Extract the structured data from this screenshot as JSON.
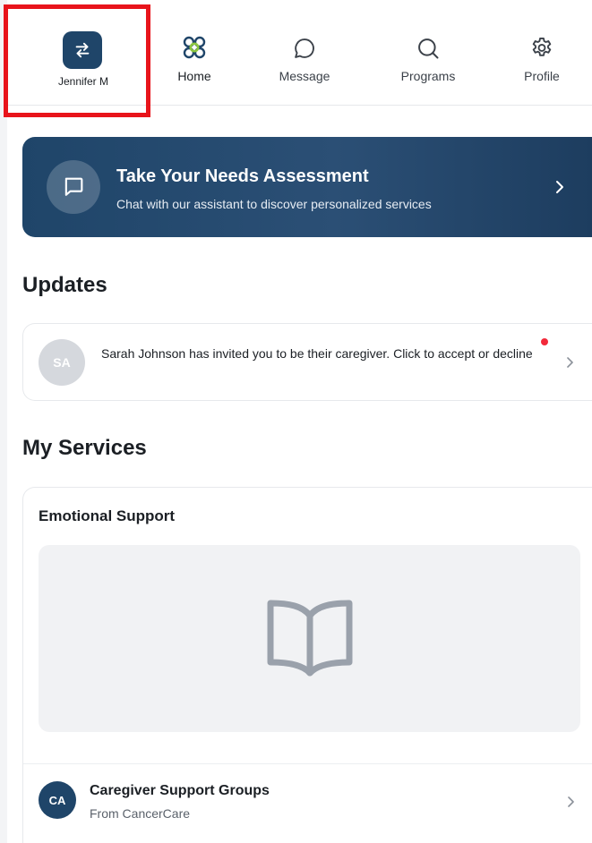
{
  "nav": {
    "switch_label": "Jennifer M",
    "items": [
      {
        "label": "Home",
        "icon": "home-logo-icon"
      },
      {
        "label": "Message",
        "icon": "message-icon"
      },
      {
        "label": "Programs",
        "icon": "search-icon"
      },
      {
        "label": "Profile",
        "icon": "gear-icon"
      }
    ]
  },
  "banner": {
    "title": "Take Your Needs Assessment",
    "subtitle": "Chat with our assistant to discover personalized services"
  },
  "updates": {
    "heading": "Updates",
    "items": [
      {
        "initials": "SA",
        "text": "Sarah Johnson has invited you to be their caregiver. Click to accept or decline"
      }
    ]
  },
  "services": {
    "heading": "My Services",
    "cards": [
      {
        "title": "Emotional Support",
        "items": [
          {
            "initials": "CA",
            "title": "Caregiver Support Groups",
            "subtitle": "From CancerCare"
          }
        ]
      }
    ]
  },
  "colors": {
    "brand_navy": "#1f4569",
    "highlight_red": "#e8141b",
    "logo_green": "#8cc63f",
    "notification_dot": "#f2293a"
  }
}
